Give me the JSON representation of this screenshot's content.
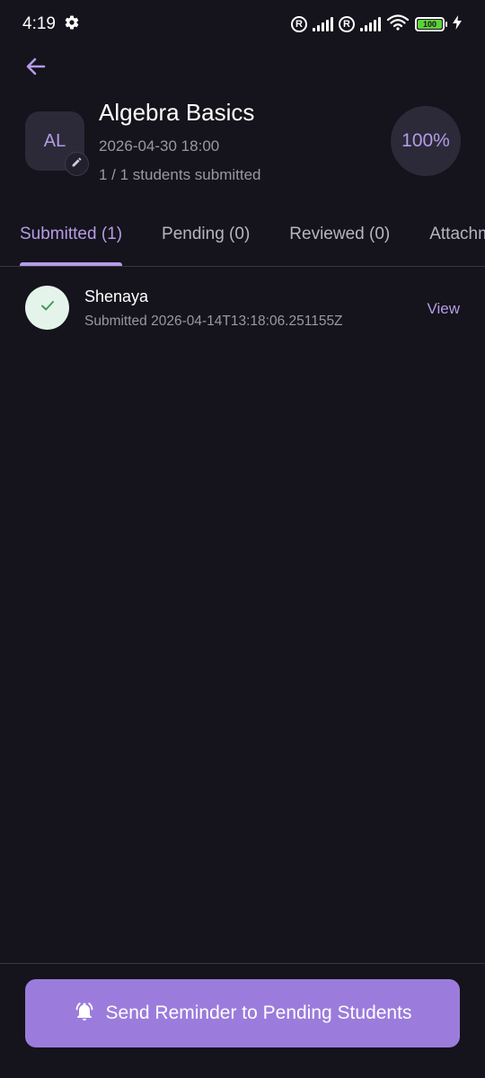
{
  "status_bar": {
    "time": "4:19",
    "settings_icon": "gear-icon",
    "registered_mark": "R",
    "battery_level": "100",
    "colors": {
      "battery_fill": "#5ed13a"
    }
  },
  "header": {
    "back_icon": "arrow-left-icon",
    "avatar_initials": "AL",
    "edit_icon": "pencil-icon",
    "title": "Algebra Basics",
    "due_date": "2026-04-30 18:00",
    "submitted_summary": "1 / 1 students submitted",
    "progress_label": "100%",
    "progress_fraction": 1.0
  },
  "tabs": [
    {
      "label": "Submitted (1)",
      "active": true
    },
    {
      "label": "Pending (0)",
      "active": false
    },
    {
      "label": "Reviewed (0)",
      "active": false
    },
    {
      "label": "Attachments",
      "active": false
    }
  ],
  "submissions": [
    {
      "status_icon": "check-icon",
      "name": "Shenaya",
      "submitted_at": "Submitted 2026-04-14T13:18:06.251155Z",
      "action_label": "View"
    }
  ],
  "footer": {
    "reminder_icon": "bell-ringing-icon",
    "reminder_label": "Send Reminder to Pending Students"
  },
  "colors": {
    "background": "#15131b",
    "accent": "#b49ce6",
    "button": "#9b7cdc",
    "success_bg": "#e5f4ea",
    "success_check": "#3f9a5c"
  }
}
